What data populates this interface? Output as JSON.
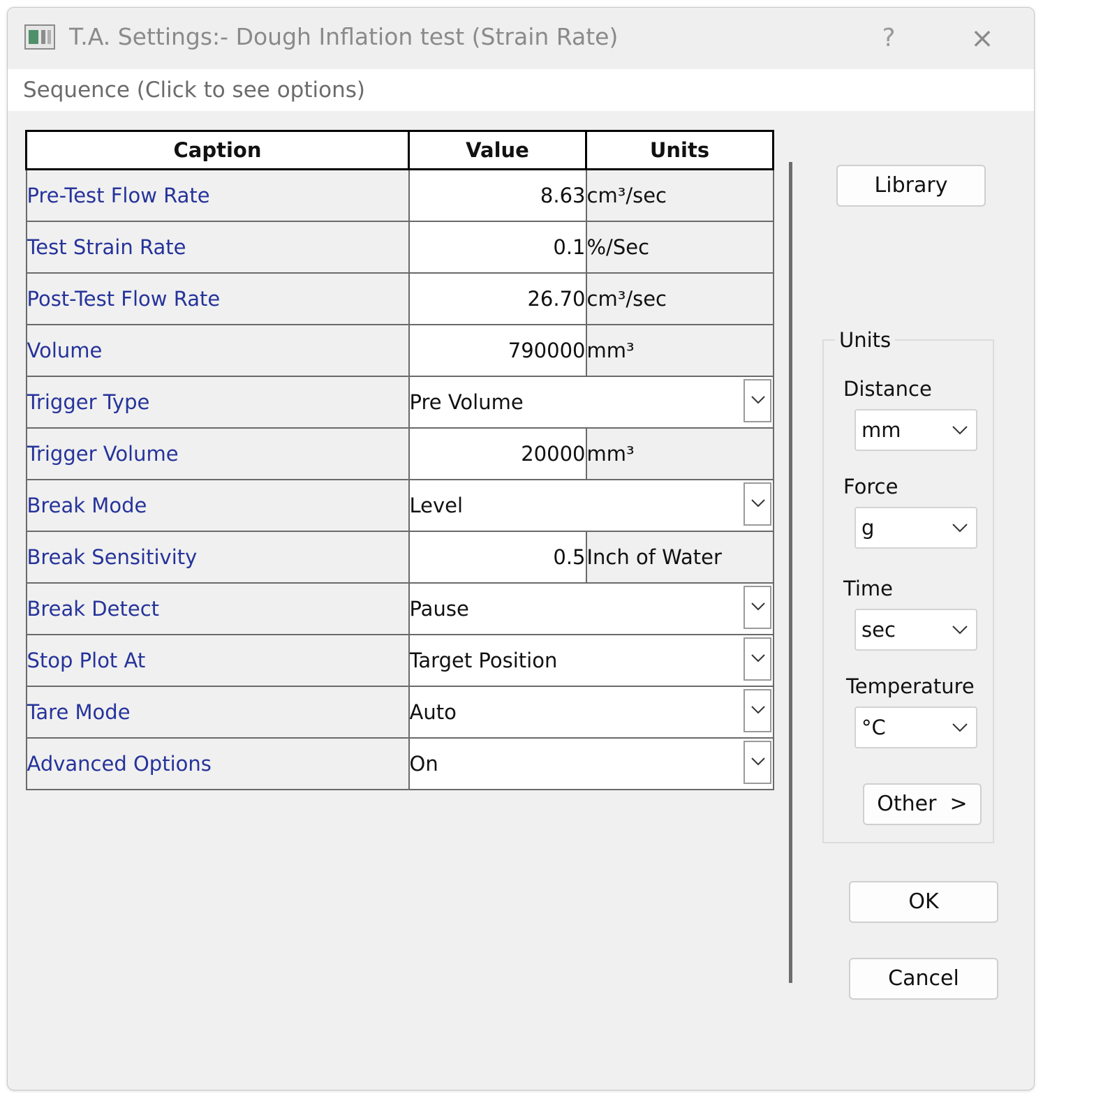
{
  "window": {
    "title": "T.A. Settings:- Dough Inflation test (Strain Rate)",
    "help_label": "?",
    "close_label": "×"
  },
  "menu": {
    "sequence_label": "Sequence (Click to see options)"
  },
  "grid": {
    "headers": [
      "Caption",
      "Value",
      "Units"
    ],
    "rows": [
      {
        "caption": "Pre-Test Flow Rate",
        "value": "8.63",
        "unit": "cm³/sec"
      },
      {
        "caption": "Test Strain Rate",
        "value": "0.1",
        "unit": "%/Sec"
      },
      {
        "caption": "Post-Test Flow Rate",
        "value": "26.70",
        "unit": "cm³/sec"
      },
      {
        "caption": "Volume",
        "value": "790000",
        "unit": "mm³"
      },
      {
        "caption": "Trigger Type",
        "value": "Pre Volume"
      },
      {
        "caption": "Trigger Volume",
        "value": "20000",
        "unit": "mm³"
      },
      {
        "caption": "Break Mode",
        "value": "Level"
      },
      {
        "caption": "Break Sensitivity",
        "value": "0.5",
        "unit": "Inch of Water"
      },
      {
        "caption": "Break Detect",
        "value": "Pause"
      },
      {
        "caption": "Stop Plot At",
        "value": "Target Position"
      },
      {
        "caption": "Tare Mode",
        "value": "Auto"
      },
      {
        "caption": "Advanced Options",
        "value": "On"
      }
    ]
  },
  "buttons": {
    "library": "Library",
    "other": "Other  >",
    "ok": "OK",
    "cancel": "Cancel"
  },
  "units": {
    "group_label": "Units",
    "distance": {
      "label": "Distance",
      "value": "mm"
    },
    "force": {
      "label": "Force",
      "value": "g"
    },
    "time": {
      "label": "Time",
      "value": "sec"
    },
    "temperature": {
      "label": "Temperature",
      "value": "°C"
    }
  },
  "colors": {
    "caption_text": "#26339a",
    "dialog_bg": "#f0f0f0",
    "title_text": "#8a8a8a"
  }
}
